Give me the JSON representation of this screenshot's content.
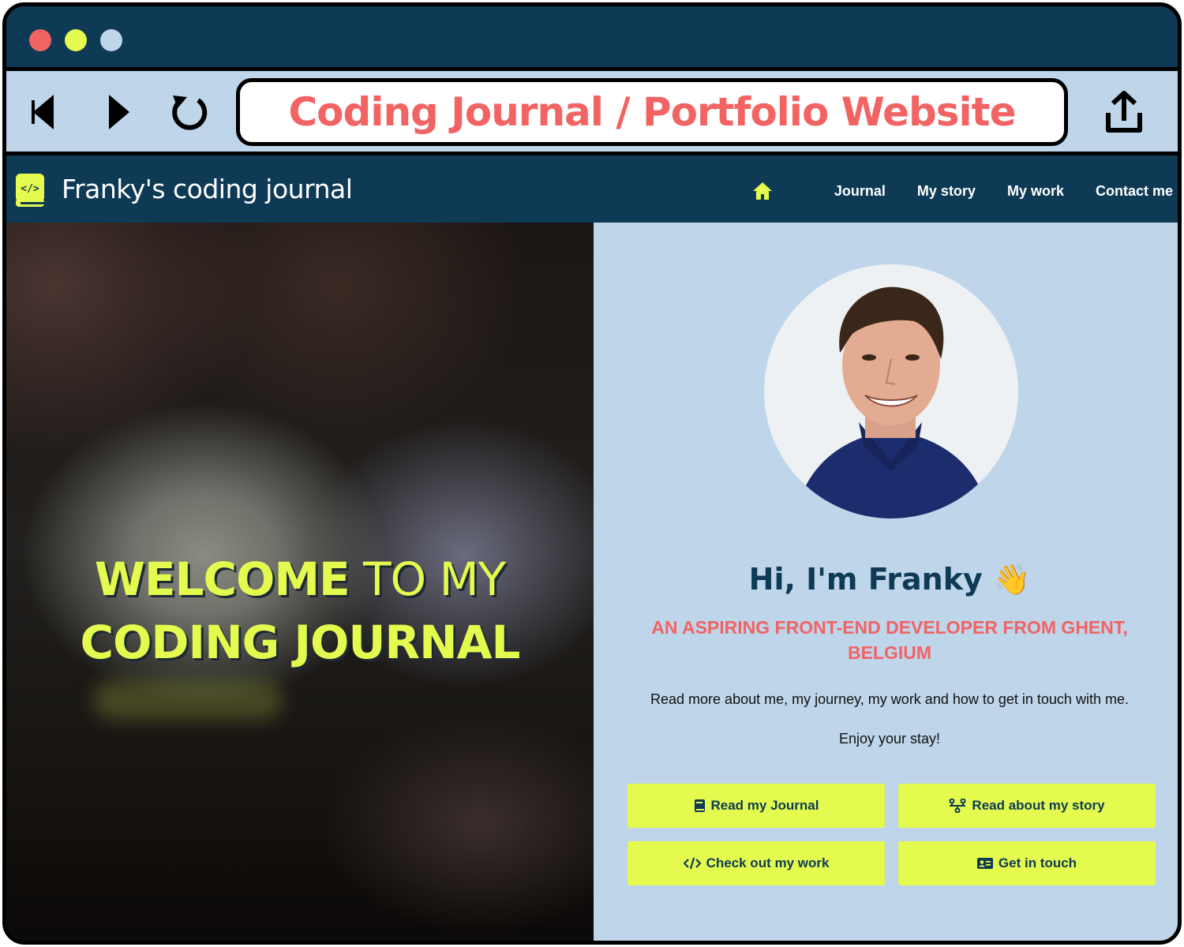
{
  "browser": {
    "address_text": "Coding Journal / Portfolio Website",
    "traffic_light_colors": [
      "#f26363",
      "#e4fa4e",
      "#bed5ea"
    ],
    "icons": [
      "back-arrow-icon",
      "forward-arrow-icon",
      "reload-icon",
      "share-icon"
    ]
  },
  "site_nav": {
    "brand": "Franky's coding journal",
    "home_icon": "home-icon",
    "items": [
      {
        "label": "Journal"
      },
      {
        "label": "My story"
      },
      {
        "label": "My work"
      },
      {
        "label": "Contact me"
      }
    ]
  },
  "hero": {
    "title_word_1": "WELCOME",
    "title_word_2": " TO MY",
    "title_line_2": "CODING JOURNAL"
  },
  "profile": {
    "greeting": "Hi, I'm Franky",
    "greeting_emoji": "👋",
    "tagline": "AN ASPIRING FRONT-END DEVELOPER FROM GHENT, BELGIUM",
    "intro": "Read more about me, my journey, my work and how to get in touch with me.",
    "closing": "Enjoy your stay!"
  },
  "buttons": [
    {
      "label": "Read my Journal",
      "icon": "book-icon"
    },
    {
      "label": "Read about my story",
      "icon": "timeline-icon"
    },
    {
      "label": "Check out my work",
      "icon": "code-icon"
    },
    {
      "label": "Get in touch",
      "icon": "contact-card-icon"
    }
  ],
  "colors": {
    "navy": "#0e3a55",
    "light_blue": "#bed5ea",
    "accent_yellow": "#e4fa4e",
    "accent_coral": "#f26363"
  }
}
